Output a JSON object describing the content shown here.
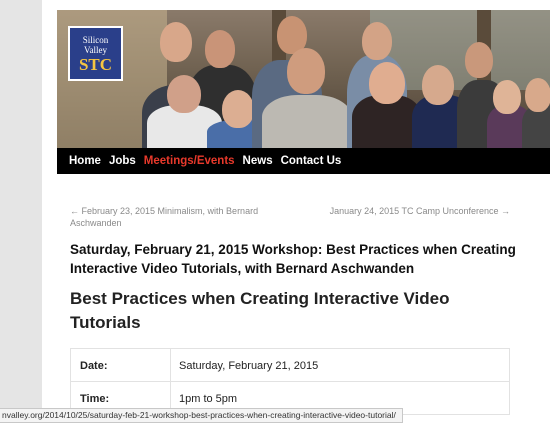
{
  "logo": {
    "line1": "Silicon",
    "line2": "Valley",
    "line3": "STC"
  },
  "nav": {
    "items": [
      "Home",
      "Jobs",
      "Meetings/Events",
      "News",
      "Contact Us"
    ],
    "active": "Meetings/Events",
    "active_color": "#e8392b"
  },
  "post_nav": {
    "prev": "← February 23, 2015 Minimalism, with Bernard Aschwanden",
    "next": "January 24, 2015 TC Camp Unconference →"
  },
  "post": {
    "title": "Saturday, February 21, 2015 Workshop: Best Practices when Creating Interactive Video Tutorials, with Bernard Aschwanden",
    "subtitle": "Best Practices when Creating Interactive Video Tutorials"
  },
  "details": [
    {
      "label": "Date:",
      "value": "Saturday, February 21, 2015"
    },
    {
      "label": "Time:",
      "value": "1pm to 5pm"
    }
  ],
  "status_bar": {
    "url": "nvalley.org/2014/10/25/saturday-feb-21-workshop-best-practices-when-creating-interactive-video-tutorial/"
  }
}
